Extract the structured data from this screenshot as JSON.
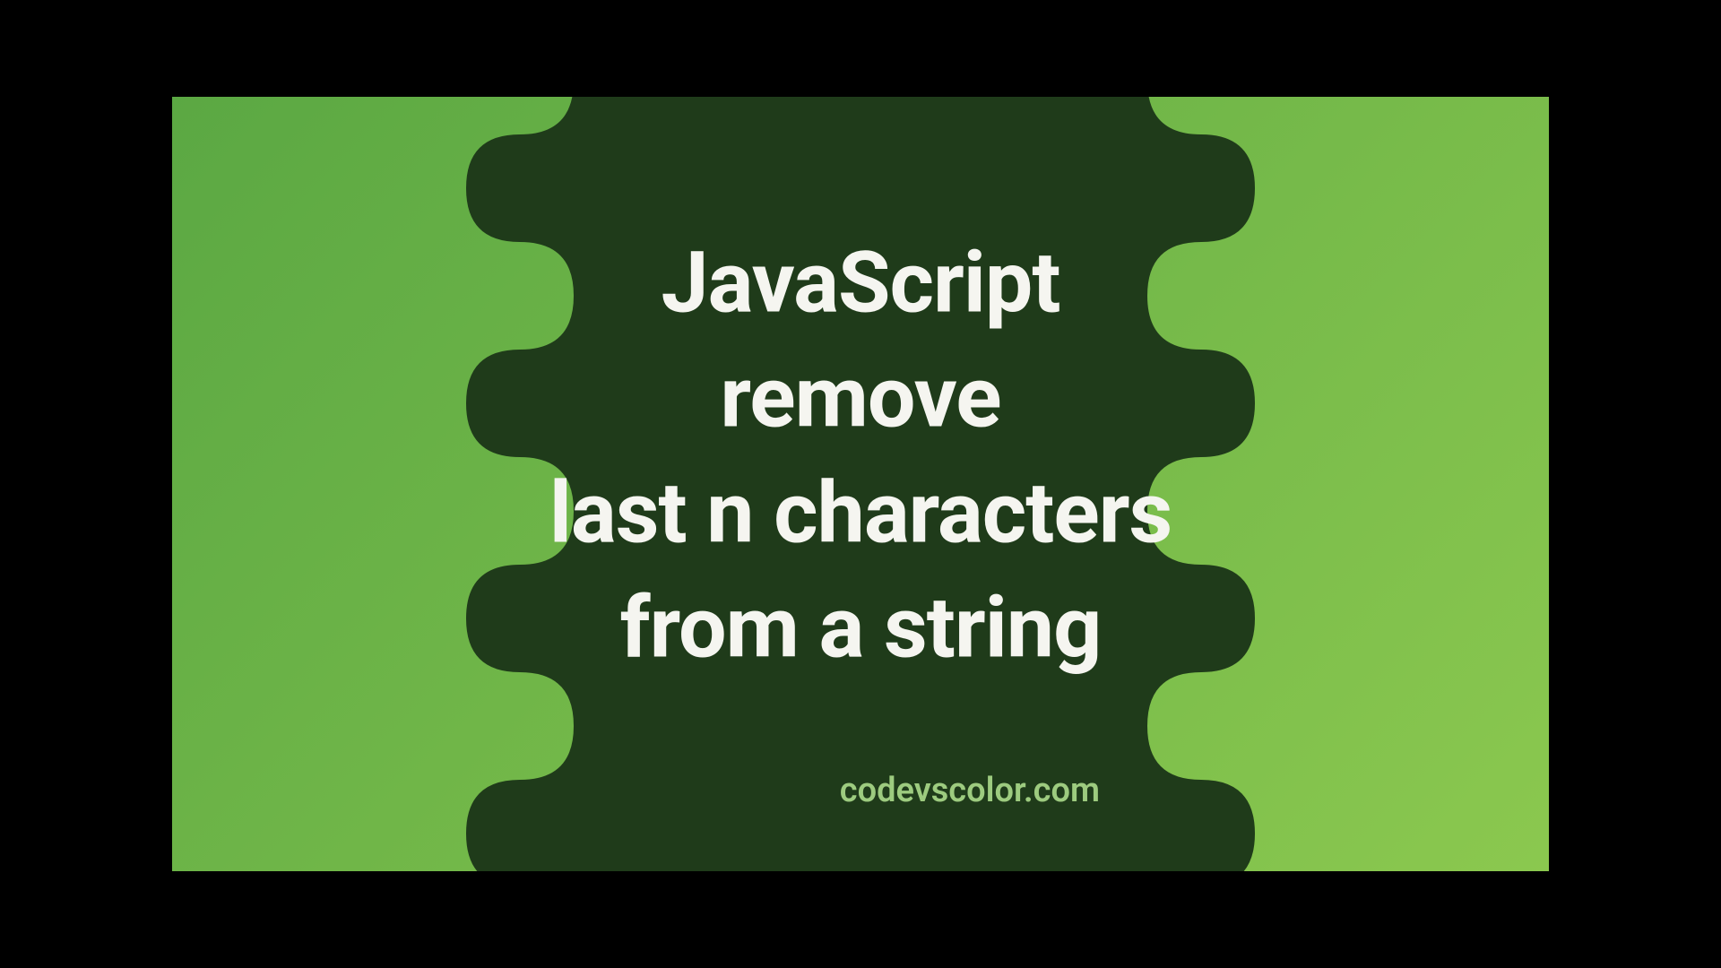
{
  "title": {
    "line1": "JavaScript",
    "line2": "remove",
    "line3": "last n characters",
    "line4": "from a string"
  },
  "attribution": "codevscolor.com",
  "colors": {
    "blobFill": "#1f3b1a",
    "textColor": "#f5f5f0",
    "attributionColor": "#9dcb7f",
    "bgGradientStart": "#5ba843",
    "bgGradientEnd": "#8bc84f"
  }
}
